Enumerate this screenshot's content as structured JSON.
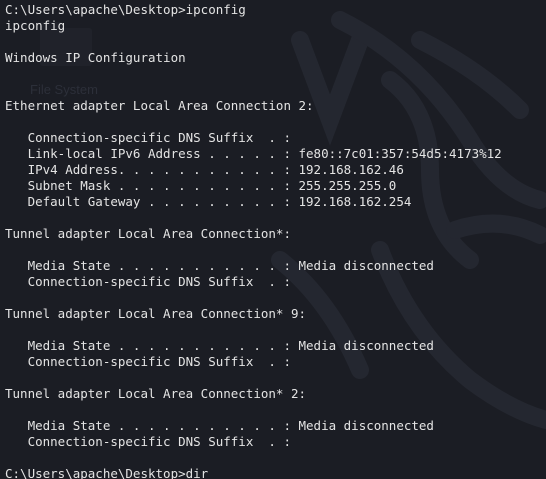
{
  "terminal": {
    "background_color": "#1b1d24",
    "text_color": "#e4e4e4",
    "wallpaper_text": "File System",
    "lines": [
      "C:\\Users\\apache\\Desktop>ipconfig",
      "ipconfig",
      "",
      "Windows IP Configuration",
      "",
      "",
      "Ethernet adapter Local Area Connection 2:",
      "",
      "   Connection-specific DNS Suffix  . :",
      "   Link-local IPv6 Address . . . . . : fe80::7c01:357:54d5:4173%12",
      "   IPv4 Address. . . . . . . . . . . : 192.168.162.46",
      "   Subnet Mask . . . . . . . . . . . : 255.255.255.0",
      "   Default Gateway . . . . . . . . . : 192.168.162.254",
      "",
      "Tunnel adapter Local Area Connection*:",
      "",
      "   Media State . . . . . . . . . . . : Media disconnected",
      "   Connection-specific DNS Suffix  . :",
      "",
      "Tunnel adapter Local Area Connection* 9:",
      "",
      "   Media State . . . . . . . . . . . : Media disconnected",
      "   Connection-specific DNS Suffix  . :",
      "",
      "Tunnel adapter Local Area Connection* 2:",
      "",
      "   Media State . . . . . . . . . . . : Media disconnected",
      "   Connection-specific DNS Suffix  . :",
      "",
      "C:\\Users\\apache\\Desktop>dir"
    ]
  }
}
